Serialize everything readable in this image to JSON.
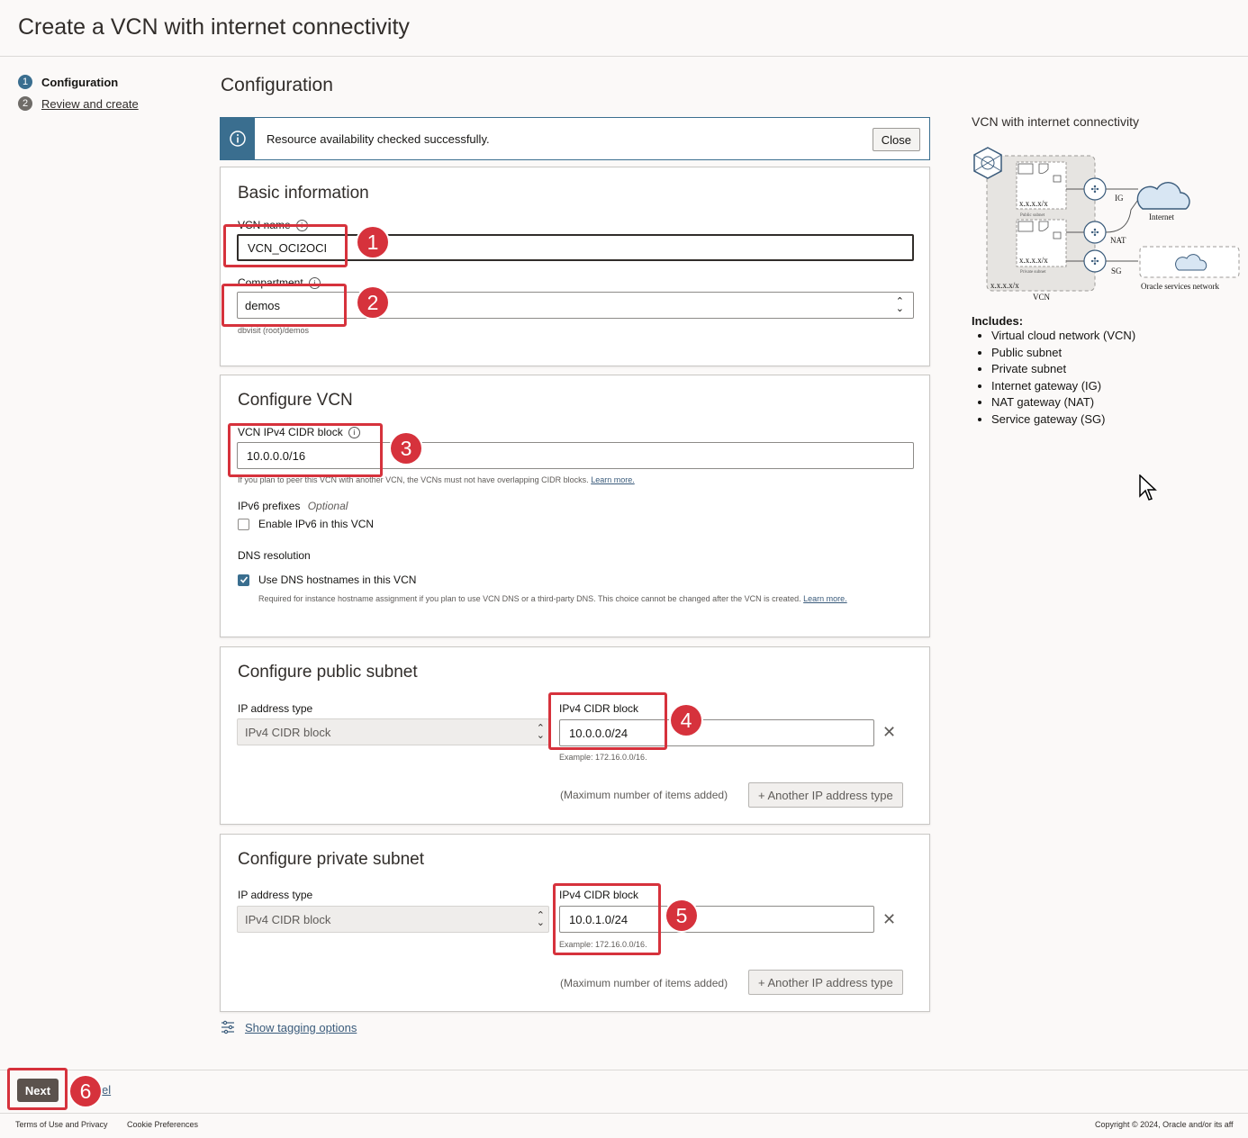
{
  "page": {
    "title": "Create a VCN with internet connectivity"
  },
  "steps": [
    {
      "number": "1",
      "label": "Configuration"
    },
    {
      "number": "2",
      "label": "Review and create"
    }
  ],
  "main": {
    "title": "Configuration"
  },
  "banner": {
    "message": "Resource availability checked successfully.",
    "close_label": "Close"
  },
  "basic": {
    "title": "Basic information",
    "vcn_name_label": "VCN name",
    "vcn_name_value": "VCN_OCI2OCI",
    "compartment_label": "Compartment",
    "compartment_value": "demos",
    "compartment_path": "dbvisit (root)/demos"
  },
  "configure_vcn": {
    "title": "Configure VCN",
    "cidr_label": "VCN IPv4 CIDR block",
    "cidr_value": "10.0.0.0/16",
    "cidr_help": "If you plan to peer this VCN with another VCN, the VCNs must not have overlapping CIDR blocks.",
    "learn_more": "Learn more.",
    "ipv6_label": "IPv6 prefixes",
    "ipv6_optional": "Optional",
    "ipv6_checkbox": "Enable IPv6 in this VCN",
    "dns_label": "DNS resolution",
    "dns_checkbox": "Use DNS hostnames in this VCN",
    "dns_help": "Required for instance hostname assignment if you plan to use VCN DNS or a third-party DNS. This choice cannot be changed after the VCN is created.",
    "dns_learn_more": "Learn more."
  },
  "public_subnet": {
    "title": "Configure public subnet",
    "ip_type_label": "IP address type",
    "ip_type_value": "IPv4 CIDR block",
    "cidr_label": "IPv4 CIDR block",
    "cidr_value": "10.0.0.0/24",
    "example": "Example: 172.16.0.0/16.",
    "max_note": "(Maximum number of items added)",
    "add_button": "+ Another IP address type"
  },
  "private_subnet": {
    "title": "Configure private subnet",
    "ip_type_label": "IP address type",
    "ip_type_value": "IPv4 CIDR block",
    "cidr_label": "IPv4 CIDR block",
    "cidr_value": "10.0.1.0/24",
    "example": "Example: 172.16.0.0/16.",
    "max_note": "(Maximum number of items added)",
    "add_button": "+ Another IP address type"
  },
  "tagging_link": "Show tagging options",
  "annotations": [
    "1",
    "2",
    "3",
    "4",
    "5",
    "6"
  ],
  "footer": {
    "next": "Next",
    "cancel_partial": "el",
    "terms": "Terms of Use and Privacy",
    "cookies": "Cookie Preferences",
    "copyright": "Copyright © 2024, Oracle and/or its aff"
  },
  "diagram": {
    "title": "VCN with internet connectivity",
    "cidr_text": "x.x.x.x/x",
    "public_subnet": "Public subnet",
    "private_subnet": "Private subnet",
    "vcn_label": "VCN",
    "ig": "IG",
    "nat": "NAT",
    "sg": "SG",
    "internet": "Internet",
    "oracle_services": "Oracle services network"
  },
  "includes": {
    "heading": "Includes:",
    "items": [
      "Virtual cloud network (VCN)",
      "Public subnet",
      "Private subnet",
      "Internet gateway (IG)",
      "NAT gateway (NAT)",
      "Service gateway (SG)"
    ]
  },
  "colors": {
    "accent": "#3a6e8f",
    "highlight": "#d6323c",
    "primary_button": "#5b524d"
  }
}
